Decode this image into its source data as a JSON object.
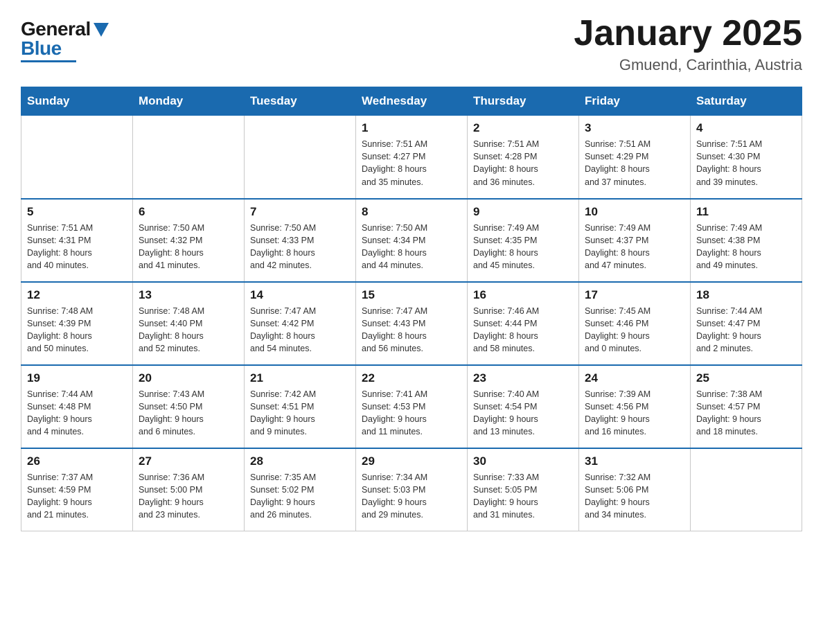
{
  "logo": {
    "general": "General",
    "blue": "Blue",
    "triangle": "▲"
  },
  "title": "January 2025",
  "subtitle": "Gmuend, Carinthia, Austria",
  "days_of_week": [
    "Sunday",
    "Monday",
    "Tuesday",
    "Wednesday",
    "Thursday",
    "Friday",
    "Saturday"
  ],
  "weeks": [
    [
      {
        "day": "",
        "info": ""
      },
      {
        "day": "",
        "info": ""
      },
      {
        "day": "",
        "info": ""
      },
      {
        "day": "1",
        "info": "Sunrise: 7:51 AM\nSunset: 4:27 PM\nDaylight: 8 hours\nand 35 minutes."
      },
      {
        "day": "2",
        "info": "Sunrise: 7:51 AM\nSunset: 4:28 PM\nDaylight: 8 hours\nand 36 minutes."
      },
      {
        "day": "3",
        "info": "Sunrise: 7:51 AM\nSunset: 4:29 PM\nDaylight: 8 hours\nand 37 minutes."
      },
      {
        "day": "4",
        "info": "Sunrise: 7:51 AM\nSunset: 4:30 PM\nDaylight: 8 hours\nand 39 minutes."
      }
    ],
    [
      {
        "day": "5",
        "info": "Sunrise: 7:51 AM\nSunset: 4:31 PM\nDaylight: 8 hours\nand 40 minutes."
      },
      {
        "day": "6",
        "info": "Sunrise: 7:50 AM\nSunset: 4:32 PM\nDaylight: 8 hours\nand 41 minutes."
      },
      {
        "day": "7",
        "info": "Sunrise: 7:50 AM\nSunset: 4:33 PM\nDaylight: 8 hours\nand 42 minutes."
      },
      {
        "day": "8",
        "info": "Sunrise: 7:50 AM\nSunset: 4:34 PM\nDaylight: 8 hours\nand 44 minutes."
      },
      {
        "day": "9",
        "info": "Sunrise: 7:49 AM\nSunset: 4:35 PM\nDaylight: 8 hours\nand 45 minutes."
      },
      {
        "day": "10",
        "info": "Sunrise: 7:49 AM\nSunset: 4:37 PM\nDaylight: 8 hours\nand 47 minutes."
      },
      {
        "day": "11",
        "info": "Sunrise: 7:49 AM\nSunset: 4:38 PM\nDaylight: 8 hours\nand 49 minutes."
      }
    ],
    [
      {
        "day": "12",
        "info": "Sunrise: 7:48 AM\nSunset: 4:39 PM\nDaylight: 8 hours\nand 50 minutes."
      },
      {
        "day": "13",
        "info": "Sunrise: 7:48 AM\nSunset: 4:40 PM\nDaylight: 8 hours\nand 52 minutes."
      },
      {
        "day": "14",
        "info": "Sunrise: 7:47 AM\nSunset: 4:42 PM\nDaylight: 8 hours\nand 54 minutes."
      },
      {
        "day": "15",
        "info": "Sunrise: 7:47 AM\nSunset: 4:43 PM\nDaylight: 8 hours\nand 56 minutes."
      },
      {
        "day": "16",
        "info": "Sunrise: 7:46 AM\nSunset: 4:44 PM\nDaylight: 8 hours\nand 58 minutes."
      },
      {
        "day": "17",
        "info": "Sunrise: 7:45 AM\nSunset: 4:46 PM\nDaylight: 9 hours\nand 0 minutes."
      },
      {
        "day": "18",
        "info": "Sunrise: 7:44 AM\nSunset: 4:47 PM\nDaylight: 9 hours\nand 2 minutes."
      }
    ],
    [
      {
        "day": "19",
        "info": "Sunrise: 7:44 AM\nSunset: 4:48 PM\nDaylight: 9 hours\nand 4 minutes."
      },
      {
        "day": "20",
        "info": "Sunrise: 7:43 AM\nSunset: 4:50 PM\nDaylight: 9 hours\nand 6 minutes."
      },
      {
        "day": "21",
        "info": "Sunrise: 7:42 AM\nSunset: 4:51 PM\nDaylight: 9 hours\nand 9 minutes."
      },
      {
        "day": "22",
        "info": "Sunrise: 7:41 AM\nSunset: 4:53 PM\nDaylight: 9 hours\nand 11 minutes."
      },
      {
        "day": "23",
        "info": "Sunrise: 7:40 AM\nSunset: 4:54 PM\nDaylight: 9 hours\nand 13 minutes."
      },
      {
        "day": "24",
        "info": "Sunrise: 7:39 AM\nSunset: 4:56 PM\nDaylight: 9 hours\nand 16 minutes."
      },
      {
        "day": "25",
        "info": "Sunrise: 7:38 AM\nSunset: 4:57 PM\nDaylight: 9 hours\nand 18 minutes."
      }
    ],
    [
      {
        "day": "26",
        "info": "Sunrise: 7:37 AM\nSunset: 4:59 PM\nDaylight: 9 hours\nand 21 minutes."
      },
      {
        "day": "27",
        "info": "Sunrise: 7:36 AM\nSunset: 5:00 PM\nDaylight: 9 hours\nand 23 minutes."
      },
      {
        "day": "28",
        "info": "Sunrise: 7:35 AM\nSunset: 5:02 PM\nDaylight: 9 hours\nand 26 minutes."
      },
      {
        "day": "29",
        "info": "Sunrise: 7:34 AM\nSunset: 5:03 PM\nDaylight: 9 hours\nand 29 minutes."
      },
      {
        "day": "30",
        "info": "Sunrise: 7:33 AM\nSunset: 5:05 PM\nDaylight: 9 hours\nand 31 minutes."
      },
      {
        "day": "31",
        "info": "Sunrise: 7:32 AM\nSunset: 5:06 PM\nDaylight: 9 hours\nand 34 minutes."
      },
      {
        "day": "",
        "info": ""
      }
    ]
  ]
}
